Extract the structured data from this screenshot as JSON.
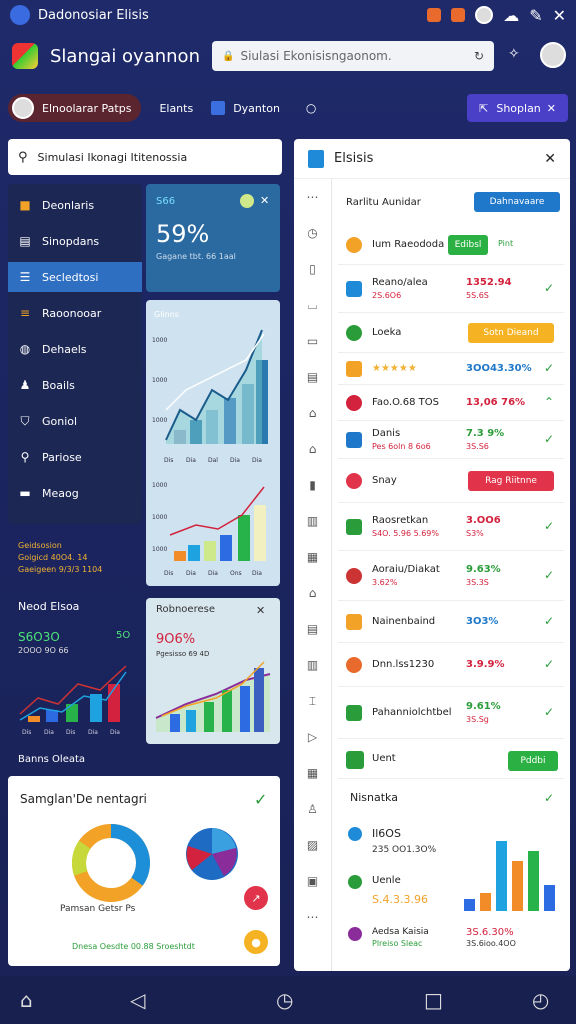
{
  "status": {
    "title": "Dadonosiar Elisis"
  },
  "header": {
    "app_title": "Slangai oyannon",
    "search_placeholder": "Siulasi Ekonisisngaonom.",
    "search_icon": "lock-icon"
  },
  "tabs": {
    "user_pill": "Elnoolarar  Patps",
    "chip1": "Elants",
    "chip2": "Dyanton",
    "right_button": "Shoplan"
  },
  "search2": {
    "text": "Simulasi Ikonagi Ititenossia"
  },
  "nav": {
    "items": [
      {
        "label": "Deonlaris",
        "icon": "dashboard-icon"
      },
      {
        "label": "Sinopdans",
        "icon": "document-icon"
      },
      {
        "label": "Secledtosi",
        "icon": "list-icon",
        "active": true
      },
      {
        "label": "Raoonooar",
        "icon": "menu-icon"
      },
      {
        "label": "Dehaels",
        "icon": "globe-icon"
      },
      {
        "label": "Boails",
        "icon": "user-icon"
      },
      {
        "label": "Goniol",
        "icon": "badge-icon"
      },
      {
        "label": "Pariose",
        "icon": "search-icon"
      },
      {
        "label": "Meaog",
        "icon": "car-icon"
      }
    ]
  },
  "nav_footer": [
    "Geidsosion",
    "Goigicd 40O4. 14",
    "Gaeigeen 9/3/3 1104"
  ],
  "stat_card": {
    "small": "S66",
    "big": "59%",
    "sub": "Gagane tbt. 66 1aal"
  },
  "chart1": {
    "label": "Glinns",
    "y": [
      "1000",
      "1000",
      "1000"
    ],
    "x": [
      "Dis",
      "Dia",
      "Dal",
      "Dia",
      "Dia"
    ]
  },
  "chart2": {
    "y": [
      "1000",
      "1000",
      "1000"
    ],
    "x": [
      "Dis",
      "Dia",
      "Dia",
      "Ons",
      "Dia"
    ]
  },
  "lower_left": {
    "title": "Neod Elsoa",
    "big": "S6O3O",
    "big_r": "5O",
    "sub": "2OOO 9O 66",
    "x": [
      "Dis",
      "Dia",
      "Dis",
      "Dia",
      "Dia"
    ],
    "footer": "Banns Oleata"
  },
  "lower_mid": {
    "title": "Robnoerese",
    "pct": "9O6%",
    "sub": "Pgesisso 69 4D"
  },
  "bottom_card": {
    "title": "Samglan'De nentagri",
    "donut_label": "Pamsan Getsr Ps",
    "footer": "Dnesa Oesdte 00.88 Sroeshtdt"
  },
  "right_panel": {
    "title": "Elsisis",
    "subhead": "Rarlitu Aunidar",
    "subhead_btn": "Dahnavaare",
    "rows": [
      {
        "t1": "Ium Raeododa",
        "t2": "",
        "v1": "",
        "v2": "",
        "btn": "Edibsl",
        "btn_color": "#2bb143",
        "tail": "Pint"
      },
      {
        "t1": "Reano/alea",
        "t2": "2S.6O6",
        "v1": "1352.94",
        "v2": "5S.6S"
      },
      {
        "t1": "Loeka",
        "t2": "",
        "v1": "",
        "v2": "",
        "btn": "Sotn Dieand",
        "btn_color": "#f5b324"
      },
      {
        "t1": "★★★★★",
        "t2": "",
        "v1": "3OO43.30%",
        "v2": ""
      },
      {
        "t1": "Fao.O.68 TOS",
        "t2": "",
        "v1": "13,06 76%",
        "v2": ""
      },
      {
        "t1": "Danis",
        "t2": "Pes 6oln 8 6o6",
        "v1": "7.3 9%",
        "v2": "3S.S6"
      },
      {
        "t1": "Snay",
        "t2": "",
        "v1": "",
        "v2": "",
        "btn": "Rag Riitnne",
        "btn_color": "#e1344a"
      },
      {
        "t1": "Raosretkan",
        "t2": "S4O. 5.96 5.69%",
        "v1": "3.OO6",
        "v2": "S3%"
      },
      {
        "t1": "Aoraiu/Diakat",
        "t2": "3.62%",
        "v1": "9.63%",
        "v2": "3S.3S"
      },
      {
        "t1": "Nainenbaind",
        "t2": "",
        "v1": "3O3%",
        "v2": ""
      },
      {
        "t1": "Dnn.lss1230",
        "t2": "",
        "v1": "3.9.9%",
        "v2": ""
      },
      {
        "t1": "Pahanniolchtbel",
        "t2": "",
        "v1": "9.61%",
        "v2": "3S.Sg"
      }
    ],
    "lower": {
      "l1": "Uent",
      "l1_btn": "Pddbi",
      "l2": "Nisnatka",
      "stat1": "Il6OS",
      "stat1_sub": "235  OO1.3O%",
      "stat2": "Uenle",
      "stat2_sub": "S.4.3.3.96",
      "stat3": "Aedsa Kaisia",
      "stat3_sub": "Plreiso Sleac",
      "stat3_val": "3S.6.30%",
      "stat3_val2": "3S.6ioo.4OO"
    }
  },
  "bar_colors": [
    "#2d6be2",
    "#f28c28",
    "#1fa3e0",
    "#f28c28",
    "#27b24a"
  ]
}
